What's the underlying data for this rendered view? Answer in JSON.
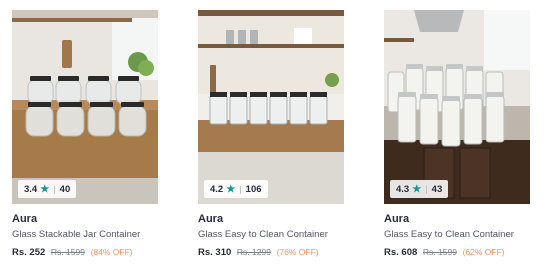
{
  "products": [
    {
      "image_alt": "glass-jars-product-image",
      "rating": "3.4",
      "rating_count": "40",
      "brand": "Aura",
      "name": "Glass Stackable Jar Container",
      "price": "Rs. 252",
      "mrp": "Rs. 1599",
      "discount": "(84% OFF)"
    },
    {
      "image_alt": "glass-jars-product-image",
      "rating": "4.2",
      "rating_count": "106",
      "brand": "Aura",
      "name": "Glass Easy to Clean Container",
      "price": "Rs. 310",
      "mrp": "Rs. 1299",
      "discount": "(76% OFF)"
    },
    {
      "image_alt": "glass-jars-product-image",
      "rating": "4.3",
      "rating_count": "43",
      "brand": "Aura",
      "name": "Glass Easy to Clean Container",
      "price": "Rs. 608",
      "mrp": "Rs. 1599",
      "discount": "(62% OFF)"
    }
  ],
  "colors": {
    "star": "#14958f",
    "discount": "#ff905a",
    "text_primary": "#282c3f",
    "text_secondary": "#535766"
  },
  "icons": {
    "rating": "star-icon"
  }
}
